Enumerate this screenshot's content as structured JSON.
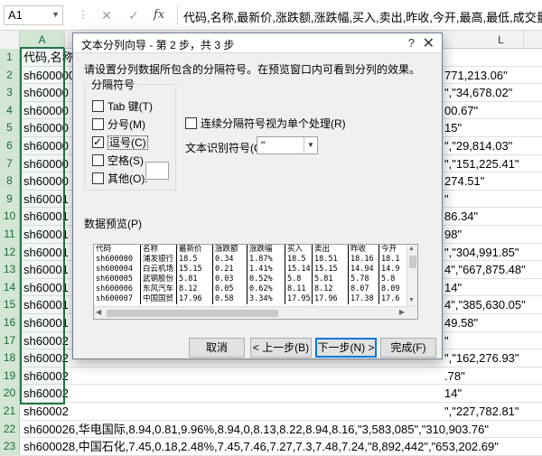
{
  "formula_bar": {
    "namebox": "A1",
    "cancel_glyph": "✕",
    "enter_glyph": "✓",
    "fx_label": "fx",
    "content": "代码,名称,最新价,涨跌额,涨跌幅,买入,卖出,昨收,今开,最高,最低,成交量（手）,成"
  },
  "columns": [
    "A",
    "L"
  ],
  "rows": [
    {
      "num": "1",
      "text": "代码,名称,最",
      "tail": ""
    },
    {
      "num": "2",
      "text": "sh600000",
      "tail": "771,213.06\""
    },
    {
      "num": "3",
      "text": "sh60000",
      "tail": "\",\"34,678.02\""
    },
    {
      "num": "4",
      "text": "sh60000",
      "tail": "00.67\""
    },
    {
      "num": "5",
      "text": "sh60000",
      "tail": "15\""
    },
    {
      "num": "6",
      "text": "sh60000",
      "tail": "\",\"29,814.03\""
    },
    {
      "num": "7",
      "text": "sh60000",
      "tail": "\",\"151,225.41\""
    },
    {
      "num": "8",
      "text": "sh60000",
      "tail": "274.51\""
    },
    {
      "num": "9",
      "text": "sh60001",
      "tail": "\""
    },
    {
      "num": "10",
      "text": "sh60001",
      "tail": "86.34\""
    },
    {
      "num": "11",
      "text": "sh60001",
      "tail": "98\""
    },
    {
      "num": "12",
      "text": "sh60001",
      "tail": "\",\"304,991.85\""
    },
    {
      "num": "13",
      "text": "sh60001",
      "tail": "4\",\"667,875.48\""
    },
    {
      "num": "14",
      "text": "sh60001",
      "tail": "14\""
    },
    {
      "num": "15",
      "text": "sh60001",
      "tail": "4\",\"385,630.05\""
    },
    {
      "num": "16",
      "text": "sh60001",
      "tail": "49.58\""
    },
    {
      "num": "17",
      "text": "sh60002",
      "tail": "\""
    },
    {
      "num": "18",
      "text": "sh60002",
      "tail": "\",\"162,276.93\""
    },
    {
      "num": "19",
      "text": "sh60002",
      "tail": ".78\""
    },
    {
      "num": "20",
      "text": "sh60002",
      "tail": "14\""
    },
    {
      "num": "21",
      "text": "sh60002",
      "tail": "\",\"227,782.81\""
    },
    {
      "num": "22",
      "text": "sh600026,华电国际,8.94,0.81,9.96%,8.94,0,8.13,8.22,8.94,8.16,\"3,583,085\",\"310,903.76\"",
      "tail": ""
    },
    {
      "num": "23",
      "text": "sh600028,中国石化,7.45,0.18,2.48%,7.45,7.46,7.27,7.3,7.48,7.24,\"8,892,442\",\"653,202.69\"",
      "tail": ""
    }
  ],
  "dialog": {
    "title": "文本分列向导 - 第 2 步，共 3 步",
    "help": "?",
    "close": "✕",
    "description": "请设置分列数据所包含的分隔符号。在预览窗口内可看到分列的效果。",
    "delimiters_title": "分隔符号",
    "delimiters": [
      {
        "label": "Tab 键(T)",
        "checked": false
      },
      {
        "label": "分号(M)",
        "checked": false
      },
      {
        "label": "逗号(C)",
        "checked": true
      },
      {
        "label": "空格(S)",
        "checked": false
      },
      {
        "label": "其他(O):",
        "checked": false
      }
    ],
    "consecutive_label": "连续分隔符号视为单个处理(R)",
    "qualifier_label": "文本识别符号(Q):",
    "qualifier_value": "\"",
    "preview_label": "数据预览(P)",
    "preview_columns": [
      [
        "代码",
        "sh600000",
        "sh600004",
        "sh600005",
        "sh600006",
        "sh600007"
      ],
      [
        "名称",
        "浦发银行",
        "白云机场",
        "武钢股份",
        "东风汽车",
        "中国国贸"
      ],
      [
        "最新价",
        "18.5",
        "15.15",
        "5.81",
        "8.12",
        "17.96"
      ],
      [
        "涨跌额",
        "0.34",
        "0.21",
        "0.03",
        "0.05",
        "0.58"
      ],
      [
        "涨跌幅",
        "1.87%",
        "1.41%",
        "0.52%",
        "0.62%",
        "3.34%"
      ],
      [
        "买入",
        "18.5",
        "15.14",
        "5.8",
        "8.11",
        "17.95"
      ],
      [
        "卖出",
        "18.51",
        "15.15",
        "5.81",
        "8.12",
        "17.96"
      ],
      [
        "昨收",
        "18.16",
        "14.94",
        "5.78",
        "8.07",
        "17.38"
      ],
      [
        "今开",
        "18.1",
        "14.9",
        "5.8",
        "8.09",
        "17.6"
      ]
    ],
    "buttons": {
      "cancel": "取消",
      "back": "< 上一步(B)",
      "next": "下一步(N) >",
      "finish": "完成(F)"
    }
  }
}
